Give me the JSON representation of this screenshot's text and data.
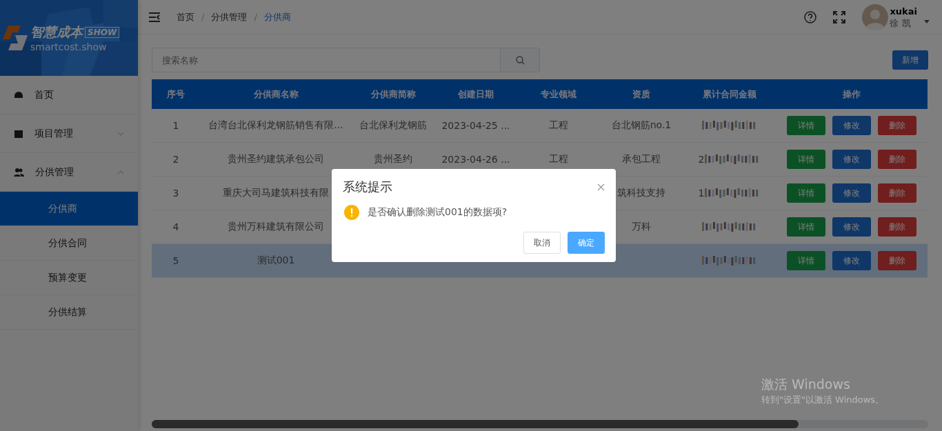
{
  "sidebar": {
    "logo": {
      "title": "智慧成本",
      "badge": "SHOW",
      "domain": "smartcost.show"
    },
    "items": [
      {
        "label": "首页",
        "selected": false
      },
      {
        "label": "项目管理",
        "selected": false,
        "expanded": false
      },
      {
        "label": "分供管理",
        "selected": false,
        "expanded": true,
        "children": [
          {
            "label": "分供商",
            "selected": true
          },
          {
            "label": "分供合同",
            "selected": false
          },
          {
            "label": "预算变更",
            "selected": false
          },
          {
            "label": "分供结算",
            "selected": false
          }
        ]
      }
    ]
  },
  "breadcrumb": {
    "separator": "/",
    "items": [
      "首页",
      "分供管理",
      "分供商"
    ]
  },
  "user": {
    "name": "xukai",
    "display_name": "徐 凯"
  },
  "search": {
    "placeholder": "搜索名称"
  },
  "add_button": "新增",
  "table": {
    "columns": [
      "序号",
      "分供商名称",
      "分供商简称",
      "创建日期",
      "专业领域",
      "资质",
      "累计合同金额",
      "操作"
    ],
    "rows": [
      {
        "index": "1",
        "name": "台湾台北保利龙钢筋销售有限...",
        "short_name": "台北保利龙钢筋",
        "date": "2023-04-25 ...",
        "field": "工程",
        "qualification": "台北钢筋no.1",
        "selected": false,
        "actions": [
          "详情",
          "修改",
          "删除"
        ]
      },
      {
        "index": "2",
        "name": "贵州圣约建筑承包公司",
        "short_name": "贵州圣约",
        "date": "2023-04-26 ...",
        "field": "工程",
        "qualification": "承包工程",
        "amount": "2",
        "selected": false,
        "actions": [
          "详情",
          "修改",
          "删除"
        ]
      },
      {
        "index": "3",
        "name": "重庆大司马建筑科技有限",
        "qualification": "筑科技支持",
        "amount": "1",
        "selected": false,
        "actions": [
          "详情",
          "修改",
          "删除"
        ]
      },
      {
        "index": "4",
        "name": "贵州万科建筑有限公司",
        "qualification": "万科",
        "selected": false,
        "actions": [
          "详情",
          "修改",
          "删除"
        ]
      },
      {
        "index": "5",
        "name": "测试001",
        "selected": true,
        "actions": [
          "详情",
          "修改",
          "删除"
        ]
      }
    ]
  },
  "dialog": {
    "title": "系统提示",
    "message": "是否确认删除测试001的数据项?",
    "cancel": "取消",
    "confirm": "确定"
  },
  "os_notice": {
    "title": "激活 Windows",
    "subtitle": "转到\"设置\"以激活 Windows。"
  }
}
